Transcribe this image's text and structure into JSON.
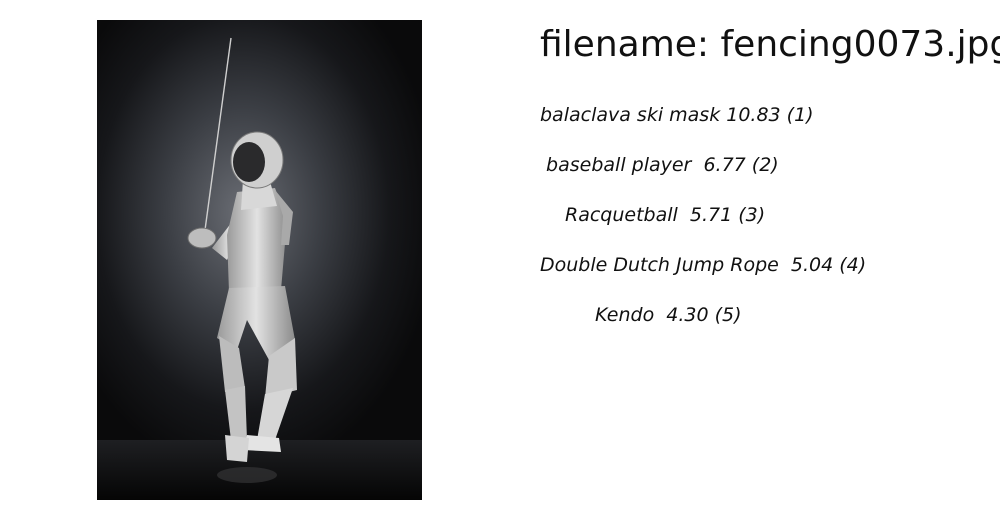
{
  "filename_text": "filename: fencing0073.jpg",
  "predictions": [
    "balaclava ski mask 10.83 (1)",
    " baseball player  6.77 (2)",
    "Racquetball  5.71 (3)",
    "Double Dutch Jump Rope  5.04 (4)",
    "Kendo  4.30 (5)"
  ]
}
